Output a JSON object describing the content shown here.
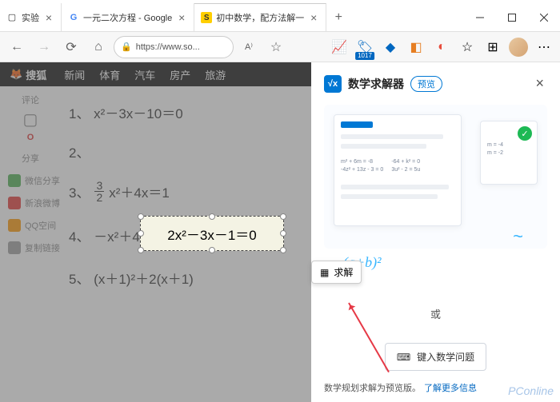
{
  "tabs": [
    {
      "icon": "⬚",
      "label": "实验"
    },
    {
      "icon": "G",
      "label": "一元二次方程 - Google"
    },
    {
      "icon": "S",
      "label": "初中数学，配方法解一"
    }
  ],
  "addr": {
    "lock": "🔒",
    "url": "https://www.so..."
  },
  "toolbar": {
    "badge": "1017"
  },
  "pagetop": {
    "logo": "搜狐",
    "nav": [
      "新闻",
      "体育",
      "汽车",
      "房产",
      "旅游"
    ]
  },
  "sidebar": {
    "comment": "评论",
    "commentCount": "O",
    "share": "分享",
    "items": [
      {
        "color": "#4caf50",
        "label": "微信分享"
      },
      {
        "color": "#e53935",
        "label": "新浪微博"
      },
      {
        "color": "#ff9800",
        "label": "QQ空间"
      },
      {
        "color": "#9e9e9e",
        "label": "复制链接"
      }
    ]
  },
  "equations": {
    "e1": "1、 x²－3x－10＝0",
    "e2num": "2、",
    "e2sel": "2x²－3x－1＝0",
    "e3a": "3、",
    "e3b": "x²＋4x＝1",
    "e4": "4、 －x²＋4x＋1＝0",
    "e5": "5、 (x＋1)²＋2(x＋1)"
  },
  "solve": {
    "label": "求解"
  },
  "panel": {
    "title": "数学求解器",
    "preview": "预览",
    "il": {
      "eq1": "m² + 6m = -8",
      "eq2": "-64 + k² = 0",
      "eq3": "-4z² + 13z - 3 = 0",
      "eq4": "3u² - 2 = 5u",
      "r1": "m = -4",
      "r2": "m = -2"
    },
    "formula": "(a+b)²",
    "or": "或",
    "typebtn": "键入数学问题",
    "footer": {
      "text": "数学规划求解为预览版。",
      "link": "了解更多信息"
    }
  },
  "watermark": "PConline"
}
